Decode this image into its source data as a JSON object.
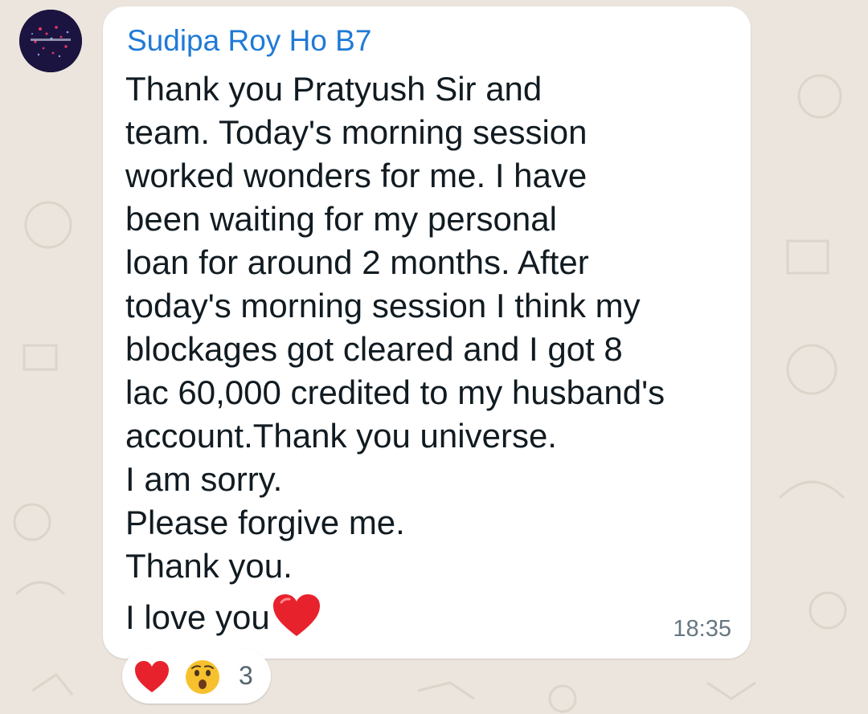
{
  "message": {
    "sender": "Sudipa Roy Ho B7",
    "lines": [
      "Thank you Pratyush Sir and",
      "team. Today's morning session",
      "worked wonders for me. I have",
      "been waiting for my personal",
      "loan for around 2 months. After",
      "today's morning session I think my",
      "blockages got cleared and I got 8",
      "lac 60,000 credited to my husband's",
      "account.Thank you universe.",
      "I am sorry.",
      "Please forgive me.",
      "Thank you."
    ],
    "last_line": "I love you",
    "last_emoji": "red-heart-emoji",
    "time": "18:35",
    "sender_color": "#1f7ad6"
  },
  "reactions": {
    "emojis": [
      "red-heart-emoji",
      "hushed-face-emoji"
    ],
    "count": "3"
  },
  "colors": {
    "wallpaper": "#ece5dd",
    "bubble": "#ffffff",
    "heart": "#e8222d",
    "emoji_face": "#f7c12e"
  }
}
